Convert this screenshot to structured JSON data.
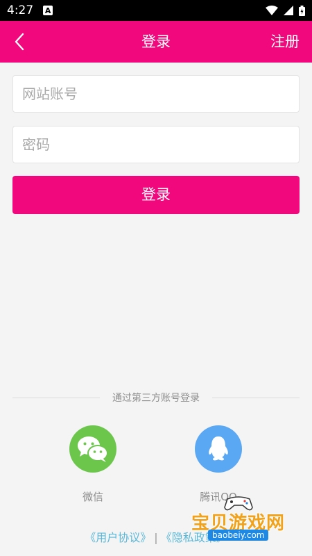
{
  "status_bar": {
    "time": "4:27",
    "notif_icon": "A"
  },
  "header": {
    "back_icon": "chevron-left",
    "title": "登录",
    "register": "注册"
  },
  "form": {
    "account_placeholder": "网站账号",
    "password_placeholder": "密码",
    "login_label": "登录"
  },
  "third_party": {
    "divider_text": "通过第三方账号登录",
    "wechat_label": "微信",
    "qq_label": "腾讯QQ"
  },
  "agreements": {
    "user_agreement": "《用户协议》",
    "separator": "|",
    "privacy_policy": "《隐私政策》"
  },
  "watermark": {
    "name": "宝贝游戏网",
    "url": "baobeiy.com"
  },
  "colors": {
    "brand": "#f0087c",
    "wechat": "#6cc64c",
    "qq": "#5aa8f4",
    "link": "#5ab8d8"
  }
}
